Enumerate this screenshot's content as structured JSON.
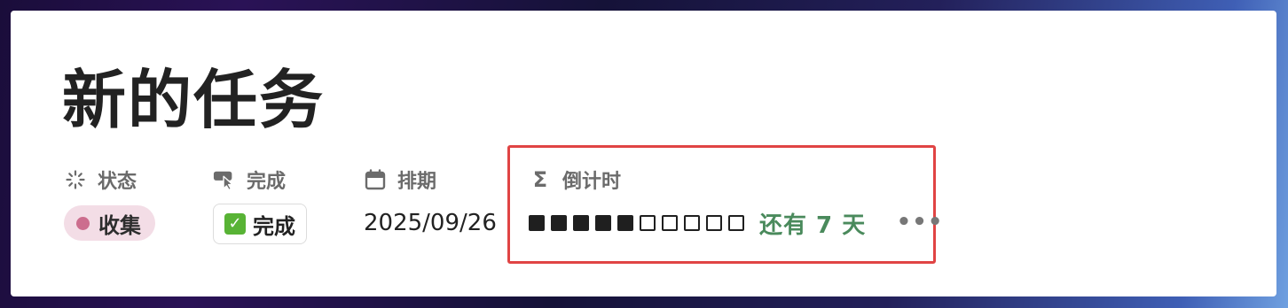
{
  "page": {
    "title": "新的任务"
  },
  "properties": {
    "status": {
      "label": "状态",
      "icon": "status-spinner-icon",
      "value": "收集",
      "dot_color": "#cc6e8e"
    },
    "done": {
      "label": "完成",
      "icon": "button-cursor-icon",
      "button_label": "完成",
      "check_glyph": "✓"
    },
    "schedule": {
      "label": "排期",
      "icon": "calendar-icon",
      "value": "2025/09/26"
    },
    "countdown": {
      "label": "倒计时",
      "icon": "sigma-icon",
      "sigma": "Σ",
      "progress": 0.5,
      "filled_blocks": 5,
      "total_blocks": 10,
      "remaining_text": "还有 7 天",
      "more": "•••"
    }
  },
  "colors": {
    "highlight": "#e04444",
    "remaining_text": "#4a8a5c",
    "status_tag_bg": "#f3dde6"
  }
}
